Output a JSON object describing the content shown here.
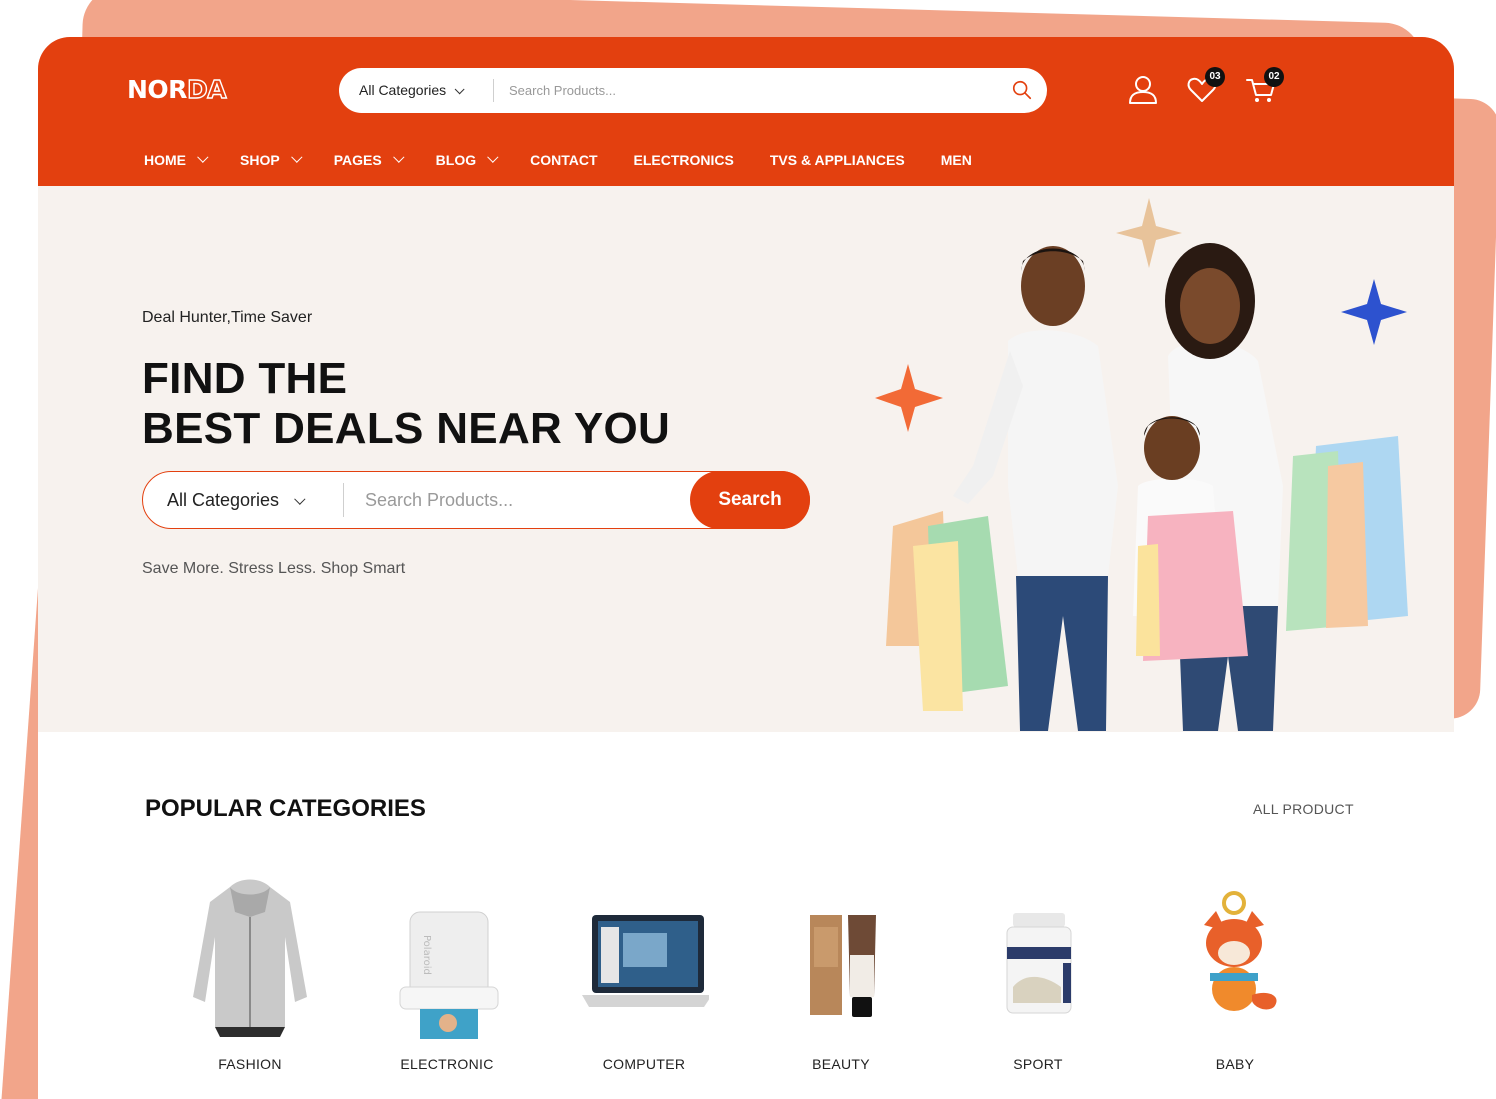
{
  "brand": {
    "logo_part1": "NOR",
    "logo_part2": "DA",
    "accent_color": "#e3400f",
    "logo_text_color": "#ffffff"
  },
  "header": {
    "search": {
      "category": "All Categories",
      "placeholder": "Search Products..."
    },
    "icons": [
      "user-icon",
      "wishlist-heart-icon",
      "cart-icon"
    ],
    "wishlist_count": "03",
    "cart_count": "02"
  },
  "nav": {
    "items": [
      {
        "label": "HOME",
        "has_dropdown": true
      },
      {
        "label": "SHOP",
        "has_dropdown": true
      },
      {
        "label": "PAGES",
        "has_dropdown": true
      },
      {
        "label": "BLOG",
        "has_dropdown": true
      },
      {
        "label": "CONTACT",
        "has_dropdown": false
      },
      {
        "label": "ELECTRONICS",
        "has_dropdown": false
      },
      {
        "label": "TVS & APPLIANCES",
        "has_dropdown": false
      },
      {
        "label": "MEN",
        "has_dropdown": false
      }
    ]
  },
  "hero": {
    "tagline": "Deal Hunter,Time Saver",
    "title_line1": "FIND THE",
    "title_line2": "BEST DEALS NEAR YOU",
    "search": {
      "category": "All Categories",
      "placeholder": "Search Products...",
      "button_label": "Search"
    },
    "subtag": "Save More. Stress Less. Shop Smart",
    "image": "family-with-shopping-bags",
    "sparkle_colors": [
      "#e8c39a",
      "#2d52cf",
      "#f26a36"
    ],
    "background_color": "#f7f2ee"
  },
  "popular": {
    "title": "POPULAR CATEGORIES",
    "all_link": "ALL PRODUCT",
    "categories": [
      {
        "label": "FASHION",
        "icon": "hoodie-jacket-image"
      },
      {
        "label": "ELECTRONIC",
        "icon": "instant-printer-image"
      },
      {
        "label": "COMPUTER",
        "icon": "laptop-image"
      },
      {
        "label": "BEAUTY",
        "icon": "cosmetics-tube-image"
      },
      {
        "label": "SPORT",
        "icon": "protein-tub-image"
      },
      {
        "label": "BABY",
        "icon": "plush-fox-toy-image"
      }
    ]
  }
}
